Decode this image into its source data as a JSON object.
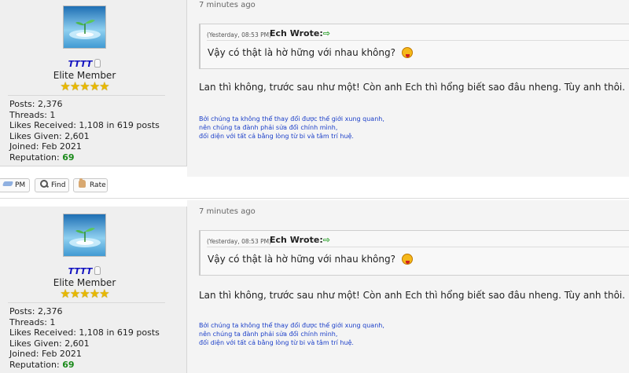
{
  "posts": [
    {
      "user": {
        "name": "TTTT",
        "title": "Elite Member",
        "stars": "★★★★★",
        "posts_label": "Posts: 2,376",
        "threads_label": "Threads: 1",
        "likes_received_label": "Likes Received: 1,108 in 619 posts",
        "likes_given_label": "Likes Given: 2,601",
        "joined_label": "Joined: Feb 2021",
        "reputation_label": "Reputation:",
        "reputation_value": "69"
      },
      "time": "7 minutes ago",
      "quote": {
        "meta": "(Yesterday, 08:53 PM)",
        "author": "Ech Wrote:",
        "text": "Vậy có thật là hờ hững với nhau không?"
      },
      "message": "Lan thì không, trước sau như một! Còn anh Ech thì hổng biết sao đâu nheng. Tùy anh thôi.",
      "signature": [
        "Bởi chúng ta không thể thay đổi được thế giới xung quanh,",
        "nên chúng ta đành phải sửa đổi chính mình,",
        "đối diện với tất cả bằng lòng từ bi và tâm trí huệ."
      ]
    },
    {
      "user": {
        "name": "TTTT",
        "title": "Elite Member",
        "stars": "★★★★★",
        "posts_label": "Posts: 2,376",
        "threads_label": "Threads: 1",
        "likes_received_label": "Likes Received: 1,108 in 619 posts",
        "likes_given_label": "Likes Given: 2,601",
        "joined_label": "Joined: Feb 2021",
        "reputation_label": "Reputation:",
        "reputation_value": "69"
      },
      "time": "7 minutes ago",
      "quote": {
        "meta": "(Yesterday, 08:53 PM)",
        "author": "Ech Wrote:",
        "text": "Vậy có thật là hờ hững với nhau không?"
      },
      "message": "Lan thì không, trước sau như một! Còn anh Ech thì hổng biết sao đâu nheng. Tùy anh thôi.",
      "signature": [
        "Bởi chúng ta không thể thay đổi được thế giới xung quanh,",
        "nên chúng ta đành phải sửa đổi chính mình,",
        "đối diện với tất cả bằng lòng từ bi và tâm trí huệ."
      ]
    }
  ],
  "actions": {
    "pm_label": "PM",
    "find_label": "Find",
    "rate_label": "Rate"
  },
  "colors": {
    "username": "#1010c0",
    "reputation": "#1a8a1a",
    "signature": "#1a3ec8",
    "arrow": "#2aa02a",
    "stars": "#e8b800"
  },
  "icons": {
    "user_status": "user-offline-icon",
    "arrow": "go-to-post-arrow-icon",
    "quote_smiley": "tongue-smiley-icon",
    "message_smiley": "grin-smiley-icon",
    "rose": "rose-icon",
    "pm": "pm-icon",
    "find": "find-icon",
    "rate": "rate-thumb-icon"
  }
}
